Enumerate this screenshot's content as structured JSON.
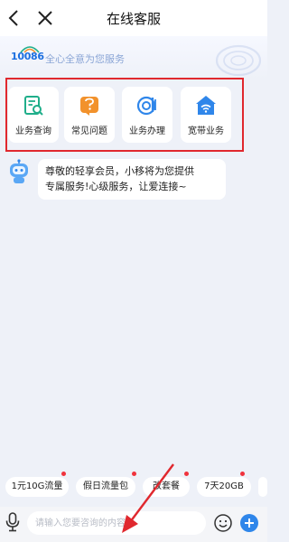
{
  "header": {
    "title": "在线客服",
    "back_icon": "chevron-left-icon",
    "close_icon": "close-icon"
  },
  "banner": {
    "logo_text": "10086",
    "slogan": "全心全意为您服务"
  },
  "services": [
    {
      "label": "业务查询",
      "icon": "search-document-icon",
      "color": "#1fae8a"
    },
    {
      "label": "常见问题",
      "icon": "question-icon",
      "color": "#f2922c"
    },
    {
      "label": "业务办理",
      "icon": "service-handle-icon",
      "color": "#2f86ea"
    },
    {
      "label": "宽带业务",
      "icon": "wifi-home-icon",
      "color": "#2f86ea"
    }
  ],
  "chat": {
    "message_line1": "尊敬的轻享会员，小移将为您提供",
    "message_line2": "专属服务!心级服务，让爱连接~"
  },
  "quick_chips": [
    {
      "label": "1元10G流量"
    },
    {
      "label": "假日流量包"
    },
    {
      "label": "改套餐"
    },
    {
      "label": "7天20GB"
    }
  ],
  "input": {
    "placeholder": "请输入您要咨询的内容"
  },
  "colors": {
    "accent": "#2f86ea",
    "highlight_frame": "#e0282e",
    "badge_dot": "#f0323c"
  }
}
